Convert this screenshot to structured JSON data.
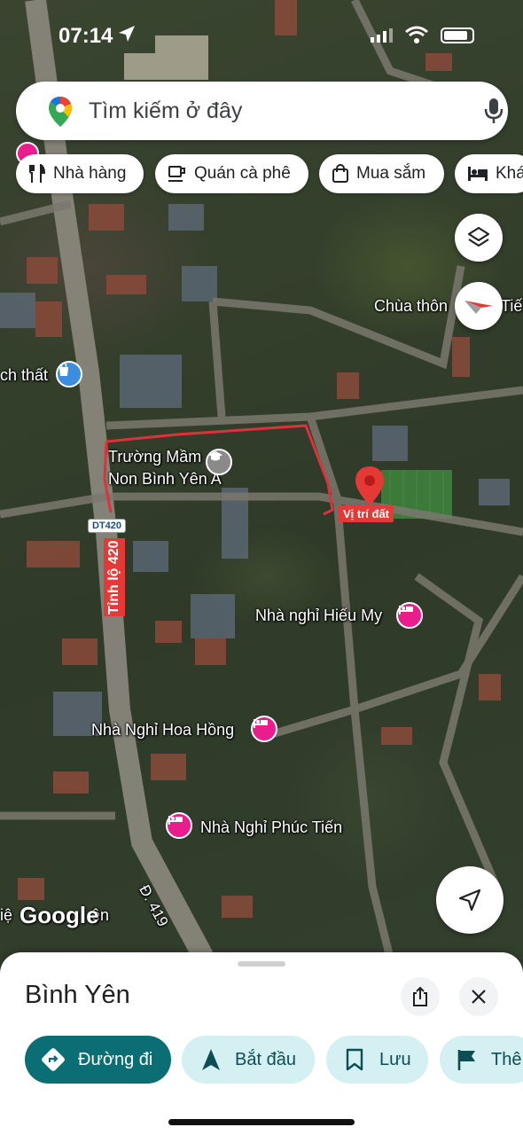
{
  "status_bar": {
    "time": "07:14"
  },
  "search": {
    "placeholder": "Tìm kiếm ở đây"
  },
  "chips": [
    {
      "label": "Nhà hàng",
      "icon": "fork-knife-icon"
    },
    {
      "label": "Quán cà phê",
      "icon": "coffee-icon"
    },
    {
      "label": "Mua sắm",
      "icon": "shopping-bag-icon"
    },
    {
      "label": "Khá",
      "icon": "bed-icon"
    }
  ],
  "map": {
    "labels": {
      "chua_thon": "Chùa thôn",
      "chua_thon_suffix": "Tiế",
      "thach_that": "ch thất",
      "truong_mam_non_line1": "Trường Mầm",
      "truong_mam_non_line2": "Non Bình Yên A",
      "vi_tri_dat": "Vị trí đất",
      "nha_nghi_hieu_my": "Nhà nghỉ Hiếu My",
      "nha_nghi_hoa_hong": "Nhà Nghỉ Hoa Hồng",
      "nha_nghi_phuc_tien": "Nhà Nghỉ Phúc Tiến",
      "road_dt420": "DT420",
      "tinh_lo_420": "Tỉnh lộ 420",
      "road_d419": "Đ. 419",
      "left_edge_text": "iệ",
      "left_edge_suffix": "ện",
      "google": "Google"
    },
    "colors": {
      "pin": "#e53935",
      "lodging": "#e91e8c",
      "school": "#8a8a8a",
      "outline": "#e0303a"
    }
  },
  "sheet": {
    "place_name": "Bình Yên",
    "actions": [
      {
        "label": "Đường đi",
        "icon": "directions-icon",
        "style": "primary"
      },
      {
        "label": "Bắt đầu",
        "icon": "navigation-arrow-icon",
        "style": "secondary"
      },
      {
        "label": "Lưu",
        "icon": "bookmark-icon",
        "style": "secondary"
      },
      {
        "label": "Thê",
        "icon": "flag-icon",
        "style": "secondary"
      }
    ]
  }
}
